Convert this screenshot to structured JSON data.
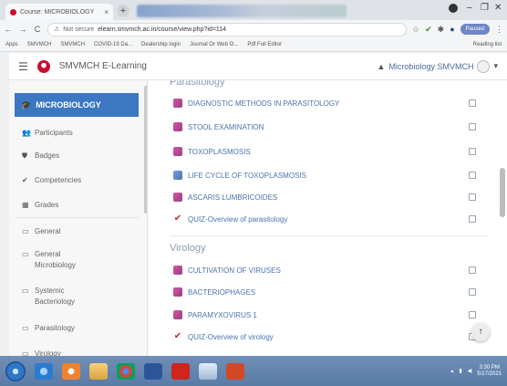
{
  "browser": {
    "tab_title": "Course: MICROBIOLOGY",
    "tab_close": "×",
    "new_tab": "+",
    "window_controls": [
      "–",
      "❐",
      "✕"
    ],
    "nav": {
      "back": "←",
      "forward": "→",
      "reload": "C"
    },
    "security_label": "Not secure",
    "url": "elearn.smvmch.ac.in/course/view.php?id=114",
    "paused_label": "Paused"
  },
  "bookmarks": {
    "items": [
      "Apps",
      "SMVMCH",
      "SMVMCH",
      "COVID-19 Da...",
      "Dealership login",
      "Journal Or Web O...",
      "Pdf Full Editor"
    ],
    "reading_list": "Reading list"
  },
  "header": {
    "site_name": "SMVMCH E-Learning",
    "user_name": "Microbiology SMVMCH",
    "menu_caret": "▾"
  },
  "sidebar": {
    "active": {
      "label": "MICROBIOLOGY",
      "icon": "graduation-cap-icon"
    },
    "items": [
      {
        "label": "Participants",
        "icon": "users-icon",
        "glyph": "👥"
      },
      {
        "label": "Badges",
        "icon": "shield-icon",
        "glyph": "⛊"
      },
      {
        "label": "Competencies",
        "icon": "check-icon",
        "glyph": "✔"
      },
      {
        "label": "Grades",
        "icon": "table-icon",
        "glyph": "▦"
      },
      {
        "label": "General",
        "icon": "folder-icon",
        "glyph": "▭"
      },
      {
        "label": "General Microbiology",
        "icon": "folder-icon",
        "glyph": "▭"
      },
      {
        "label": "Systemic Bacteriology",
        "icon": "folder-icon",
        "glyph": "▭"
      },
      {
        "label": "Parasitology",
        "icon": "folder-icon",
        "glyph": "▭"
      },
      {
        "label": "Virology",
        "icon": "folder-icon",
        "glyph": "▭"
      }
    ]
  },
  "sections": [
    {
      "title": "Parasitology",
      "activities": [
        {
          "name": "DIAGNOSTIC METHODS IN PARASITOLOGY",
          "type": "page"
        },
        {
          "name": "STOOL EXAMINATION",
          "type": "page"
        },
        {
          "name": "TOXOPLASMOSIS",
          "type": "page"
        },
        {
          "name": "LIFE CYCLE OF TOXOPLASMOSIS",
          "type": "file"
        },
        {
          "name": "ASCARIS LUMBRICOIDES",
          "type": "page"
        },
        {
          "name": "QUIZ-Overview of parasitology",
          "type": "quiz"
        }
      ]
    },
    {
      "title": "Virology",
      "activities": [
        {
          "name": "CULTIVATION OF VIRUSES",
          "type": "page"
        },
        {
          "name": "BACTERIOPHAGES",
          "type": "page"
        },
        {
          "name": "PARAMYXOVIRUS 1",
          "type": "page"
        },
        {
          "name": "QUIZ-Overview of virology",
          "type": "quiz"
        }
      ]
    }
  ],
  "back_to_top": "↑",
  "taskbar": {
    "clock_time": "3:30 PM",
    "clock_date": "5/17/2021"
  },
  "colors": {
    "accent": "#3c77c1",
    "link": "#4a74ad",
    "brand_red": "#c8102e"
  }
}
